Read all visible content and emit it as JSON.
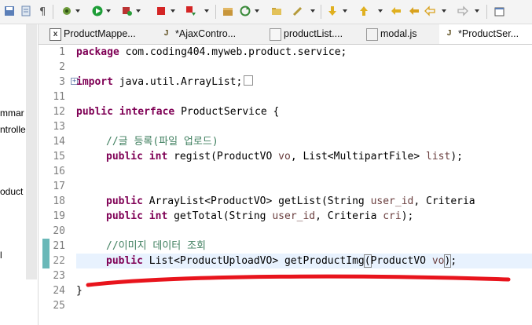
{
  "toolbar": {
    "icons": [
      "save-all-icon",
      "history-icon",
      "paragraph-icon",
      "debug-icon",
      "run-icon",
      "coverage-icon",
      "stop-icon",
      "external-tools-icon",
      "new-package-icon",
      "refresh-icon",
      "open-folder-icon",
      "wrench-icon",
      "next-annotation-icon",
      "previous-annotation-icon",
      "last-edit-icon",
      "back-icon",
      "forward-icon",
      "new-window-icon"
    ]
  },
  "left_panel": {
    "items": [
      "mmar",
      "ntrolle",
      "oduct",
      "l"
    ]
  },
  "tabs": [
    {
      "label": "ProductMappe...",
      "icon": "x"
    },
    {
      "label": "*AjaxContro...",
      "icon": "J"
    },
    {
      "label": "productList....",
      "icon": "doc"
    },
    {
      "label": "modal.js",
      "icon": "js"
    },
    {
      "label": "*ProductSer...",
      "icon": "J"
    }
  ],
  "editor": {
    "line_numbers": [
      "1",
      "2",
      "3",
      "11",
      "12",
      "13",
      "14",
      "15",
      "16",
      "17",
      "18",
      "19",
      "20",
      "21",
      "22",
      "23",
      "24",
      "25"
    ],
    "lines": {
      "l1_kw": "package",
      "l1_rest": " com.coding404.myweb.product.service;",
      "l3_kw": "import",
      "l3_rest": " java.util.ArrayList;",
      "l12_kw1": "public",
      "l12_kw2": "interface",
      "l12_rest": " ProductService {",
      "l14_comment": "//글 등록(파일 업로드)",
      "l15_kw1": "public",
      "l15_kw2": "int",
      "l15_a": " regist(ProductVO ",
      "l15_p1": "vo",
      "l15_b": ", List<MultipartFile> ",
      "l15_p2": "list",
      "l15_c": ");",
      "l18_kw": "public",
      "l18_a": " ArrayList<ProductVO> getList(String ",
      "l18_p1": "user_id",
      "l18_b": ", Criteria",
      "l19_kw1": "public",
      "l19_kw2": "int",
      "l19_a": " getTotal(String ",
      "l19_p1": "user_id",
      "l19_b": ", Criteria ",
      "l19_p2": "cri",
      "l19_c": ");",
      "l21_comment": "//이미지 데이터 조회",
      "l22_kw": "public",
      "l22_a": " List<ProductUploadVO> getProductImg",
      "l22_br1": "(",
      "l22_b": "ProductVO ",
      "l22_p1": "vo",
      "l22_br2": ")",
      "l22_c": ";",
      "l24": "}"
    }
  },
  "colors": {
    "keyword": "#7f0055",
    "comment": "#3f7f5f",
    "parameter": "#6a3e3e",
    "annotation_stroke": "#e8141c"
  }
}
